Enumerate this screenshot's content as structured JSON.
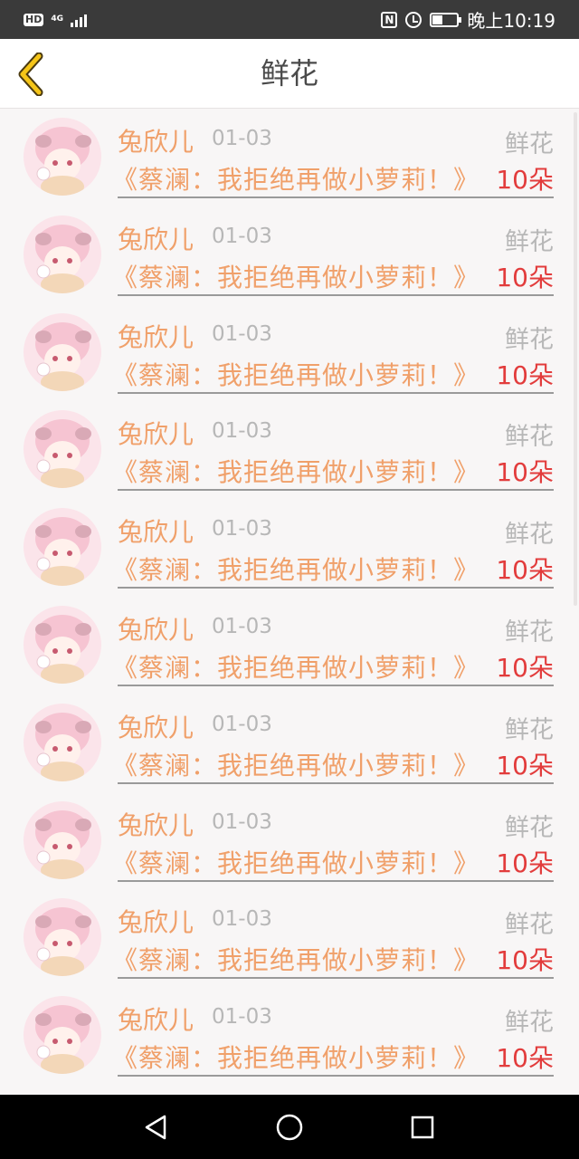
{
  "status_bar": {
    "hd": "HD",
    "network": "4G",
    "nfc": "N",
    "time": "晚上10:19"
  },
  "header": {
    "title": "鲜花"
  },
  "list": [
    {
      "username": "兔欣儿",
      "date": "01-03",
      "gift": "鲜花",
      "book": "《蔡澜：我拒绝再做小萝莉！》",
      "amount": "10朵"
    },
    {
      "username": "兔欣儿",
      "date": "01-03",
      "gift": "鲜花",
      "book": "《蔡澜：我拒绝再做小萝莉！》",
      "amount": "10朵"
    },
    {
      "username": "兔欣儿",
      "date": "01-03",
      "gift": "鲜花",
      "book": "《蔡澜：我拒绝再做小萝莉！》",
      "amount": "10朵"
    },
    {
      "username": "兔欣儿",
      "date": "01-03",
      "gift": "鲜花",
      "book": "《蔡澜：我拒绝再做小萝莉！》",
      "amount": "10朵"
    },
    {
      "username": "兔欣儿",
      "date": "01-03",
      "gift": "鲜花",
      "book": "《蔡澜：我拒绝再做小萝莉！》",
      "amount": "10朵"
    },
    {
      "username": "兔欣儿",
      "date": "01-03",
      "gift": "鲜花",
      "book": "《蔡澜：我拒绝再做小萝莉！》",
      "amount": "10朵"
    },
    {
      "username": "兔欣儿",
      "date": "01-03",
      "gift": "鲜花",
      "book": "《蔡澜：我拒绝再做小萝莉！》",
      "amount": "10朵"
    },
    {
      "username": "兔欣儿",
      "date": "01-03",
      "gift": "鲜花",
      "book": "《蔡澜：我拒绝再做小萝莉！》",
      "amount": "10朵"
    },
    {
      "username": "兔欣儿",
      "date": "01-03",
      "gift": "鲜花",
      "book": "《蔡澜：我拒绝再做小萝莉！》",
      "amount": "10朵"
    },
    {
      "username": "兔欣儿",
      "date": "01-03",
      "gift": "鲜花",
      "book": "《蔡澜：我拒绝再做小萝莉！》",
      "amount": "10朵"
    }
  ],
  "icons": {
    "back": "chevron-left-icon",
    "nav_back": "triangle-back-icon",
    "nav_home": "circle-home-icon",
    "nav_recent": "square-recent-icon"
  },
  "colors": {
    "accent_orange": "#f0a06a",
    "amount_red": "#e23c3c",
    "back_arrow_yellow": "#f5c518",
    "muted_gray": "#b7b7b7"
  },
  "battery_level": 0.4
}
